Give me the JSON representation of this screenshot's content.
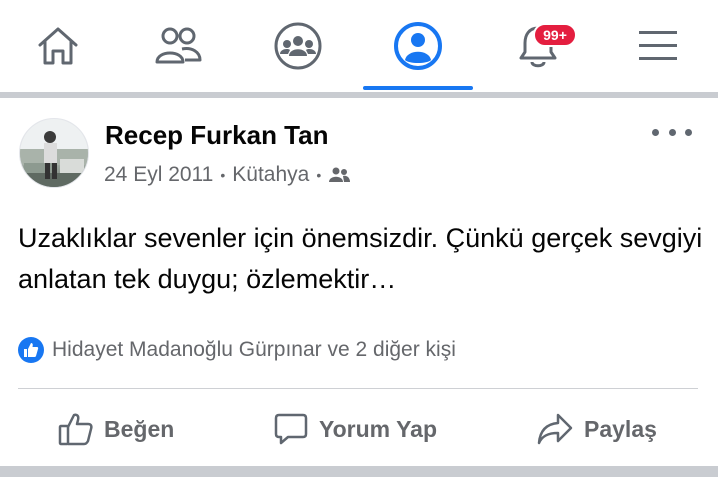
{
  "nav": {
    "items": [
      "home-icon",
      "friends-icon",
      "groups-icon",
      "profile-icon",
      "notifications-icon",
      "menu-icon"
    ],
    "active": "profile-icon",
    "notification_badge": "99+",
    "accent_color": "#1877f2",
    "badge_color": "#e41e3f"
  },
  "post": {
    "author": "Recep Furkan Tan",
    "date": "24 Eyl 2011",
    "location": "Kütahya",
    "audience_icon": "friends-icon",
    "text": "Uzaklıklar sevenler için önemsizdir. Çünkü gerçek sevgiyi anlatan tek duygu; özlemektir…",
    "reactions_text": "Hidayet Madanoğlu Gürpınar ve 2 diğer kişi"
  },
  "actions": {
    "like": "Beğen",
    "comment": "Yorum Yap",
    "share": "Paylaş"
  }
}
